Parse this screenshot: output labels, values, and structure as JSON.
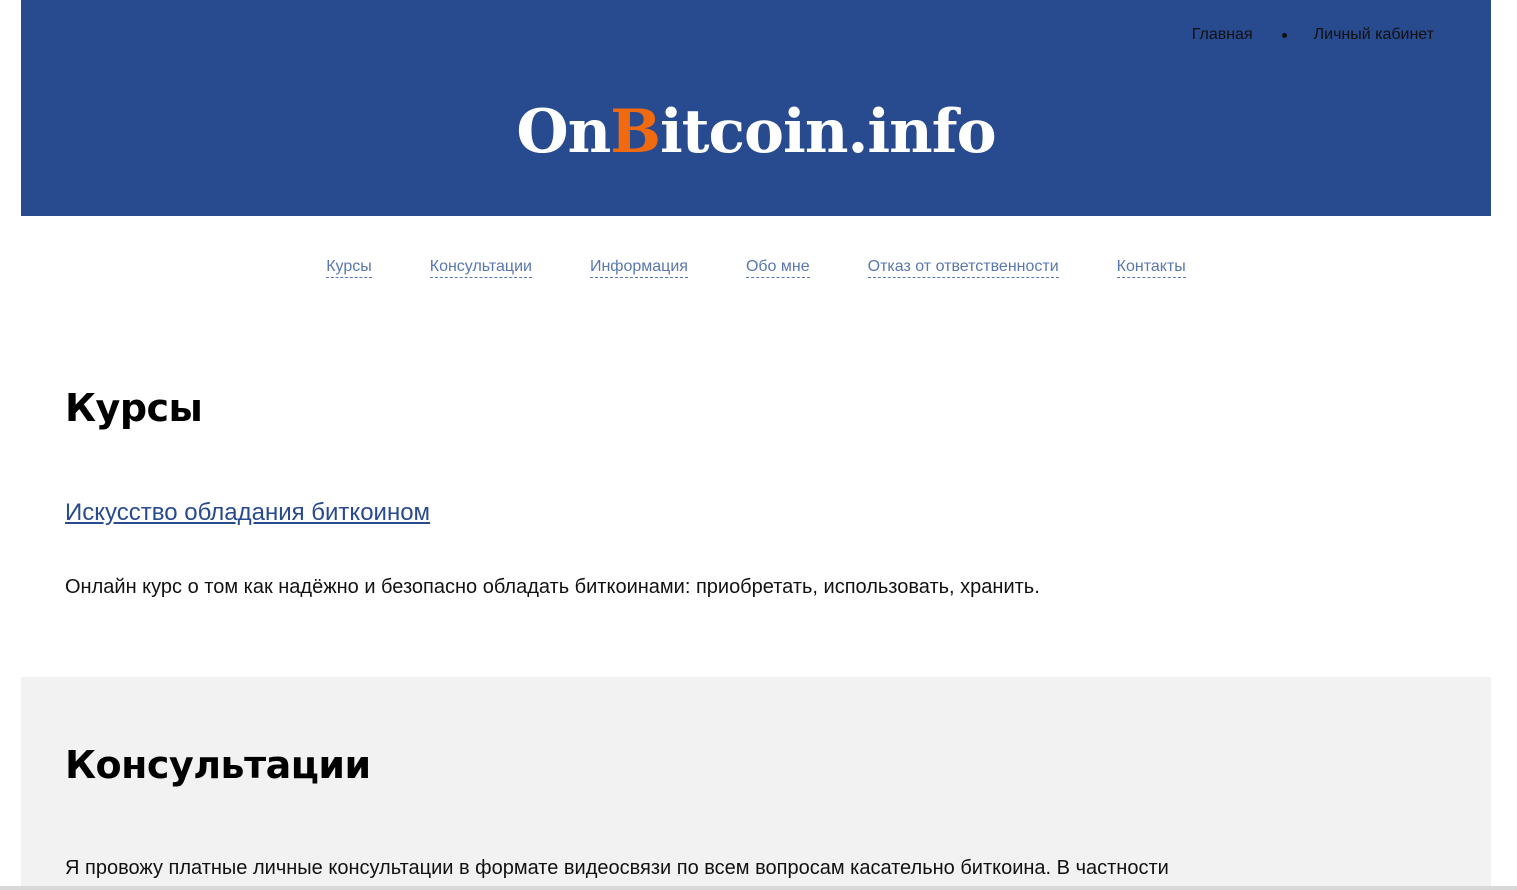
{
  "header": {
    "top_nav": [
      {
        "label": "Главная"
      },
      {
        "label": "Личный кабинет"
      }
    ],
    "logo": {
      "part1": "On",
      "part2": "B",
      "part3": "itcoin.info",
      "brand_color": "#284a8e",
      "accent_color": "#f26a0f"
    }
  },
  "main_nav": [
    {
      "label": "Курсы"
    },
    {
      "label": "Консультации"
    },
    {
      "label": "Информация"
    },
    {
      "label": "Обо мне"
    },
    {
      "label": "Отказ от ответственности"
    },
    {
      "label": "Контакты"
    }
  ],
  "courses": {
    "title": "Курсы",
    "items": [
      {
        "link": "Искусство обладания биткоином",
        "description": "Онлайн курс о том как надёжно и безопасно обладать биткоинами: приобретать, использовать, хранить."
      }
    ]
  },
  "consultations": {
    "title": "Консультации",
    "text": "Я провожу платные личные консультации в формате видеосвязи по всем вопросам касательно биткоина. В частности"
  }
}
